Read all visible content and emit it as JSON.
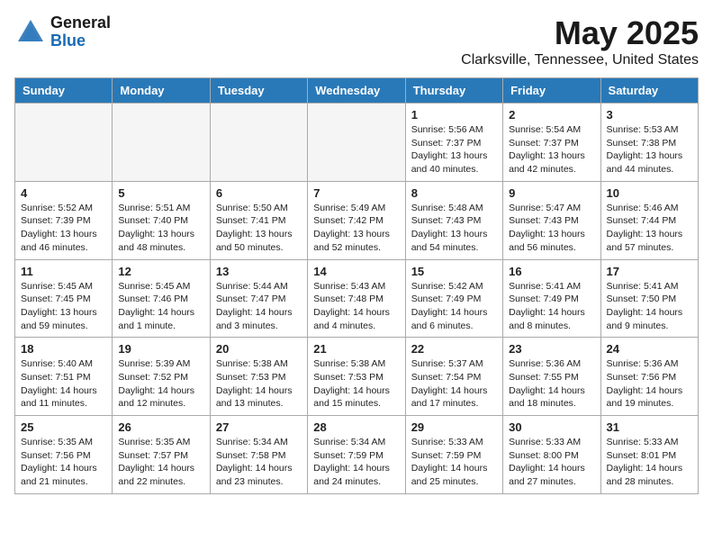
{
  "header": {
    "logo_general": "General",
    "logo_blue": "Blue",
    "month_title": "May 2025",
    "location": "Clarksville, Tennessee, United States"
  },
  "weekdays": [
    "Sunday",
    "Monday",
    "Tuesday",
    "Wednesday",
    "Thursday",
    "Friday",
    "Saturday"
  ],
  "weeks": [
    [
      {
        "day": "",
        "info": ""
      },
      {
        "day": "",
        "info": ""
      },
      {
        "day": "",
        "info": ""
      },
      {
        "day": "",
        "info": ""
      },
      {
        "day": "1",
        "info": "Sunrise: 5:56 AM\nSunset: 7:37 PM\nDaylight: 13 hours\nand 40 minutes."
      },
      {
        "day": "2",
        "info": "Sunrise: 5:54 AM\nSunset: 7:37 PM\nDaylight: 13 hours\nand 42 minutes."
      },
      {
        "day": "3",
        "info": "Sunrise: 5:53 AM\nSunset: 7:38 PM\nDaylight: 13 hours\nand 44 minutes."
      }
    ],
    [
      {
        "day": "4",
        "info": "Sunrise: 5:52 AM\nSunset: 7:39 PM\nDaylight: 13 hours\nand 46 minutes."
      },
      {
        "day": "5",
        "info": "Sunrise: 5:51 AM\nSunset: 7:40 PM\nDaylight: 13 hours\nand 48 minutes."
      },
      {
        "day": "6",
        "info": "Sunrise: 5:50 AM\nSunset: 7:41 PM\nDaylight: 13 hours\nand 50 minutes."
      },
      {
        "day": "7",
        "info": "Sunrise: 5:49 AM\nSunset: 7:42 PM\nDaylight: 13 hours\nand 52 minutes."
      },
      {
        "day": "8",
        "info": "Sunrise: 5:48 AM\nSunset: 7:43 PM\nDaylight: 13 hours\nand 54 minutes."
      },
      {
        "day": "9",
        "info": "Sunrise: 5:47 AM\nSunset: 7:43 PM\nDaylight: 13 hours\nand 56 minutes."
      },
      {
        "day": "10",
        "info": "Sunrise: 5:46 AM\nSunset: 7:44 PM\nDaylight: 13 hours\nand 57 minutes."
      }
    ],
    [
      {
        "day": "11",
        "info": "Sunrise: 5:45 AM\nSunset: 7:45 PM\nDaylight: 13 hours\nand 59 minutes."
      },
      {
        "day": "12",
        "info": "Sunrise: 5:45 AM\nSunset: 7:46 PM\nDaylight: 14 hours\nand 1 minute."
      },
      {
        "day": "13",
        "info": "Sunrise: 5:44 AM\nSunset: 7:47 PM\nDaylight: 14 hours\nand 3 minutes."
      },
      {
        "day": "14",
        "info": "Sunrise: 5:43 AM\nSunset: 7:48 PM\nDaylight: 14 hours\nand 4 minutes."
      },
      {
        "day": "15",
        "info": "Sunrise: 5:42 AM\nSunset: 7:49 PM\nDaylight: 14 hours\nand 6 minutes."
      },
      {
        "day": "16",
        "info": "Sunrise: 5:41 AM\nSunset: 7:49 PM\nDaylight: 14 hours\nand 8 minutes."
      },
      {
        "day": "17",
        "info": "Sunrise: 5:41 AM\nSunset: 7:50 PM\nDaylight: 14 hours\nand 9 minutes."
      }
    ],
    [
      {
        "day": "18",
        "info": "Sunrise: 5:40 AM\nSunset: 7:51 PM\nDaylight: 14 hours\nand 11 minutes."
      },
      {
        "day": "19",
        "info": "Sunrise: 5:39 AM\nSunset: 7:52 PM\nDaylight: 14 hours\nand 12 minutes."
      },
      {
        "day": "20",
        "info": "Sunrise: 5:38 AM\nSunset: 7:53 PM\nDaylight: 14 hours\nand 13 minutes."
      },
      {
        "day": "21",
        "info": "Sunrise: 5:38 AM\nSunset: 7:53 PM\nDaylight: 14 hours\nand 15 minutes."
      },
      {
        "day": "22",
        "info": "Sunrise: 5:37 AM\nSunset: 7:54 PM\nDaylight: 14 hours\nand 17 minutes."
      },
      {
        "day": "23",
        "info": "Sunrise: 5:36 AM\nSunset: 7:55 PM\nDaylight: 14 hours\nand 18 minutes."
      },
      {
        "day": "24",
        "info": "Sunrise: 5:36 AM\nSunset: 7:56 PM\nDaylight: 14 hours\nand 19 minutes."
      }
    ],
    [
      {
        "day": "25",
        "info": "Sunrise: 5:35 AM\nSunset: 7:56 PM\nDaylight: 14 hours\nand 21 minutes."
      },
      {
        "day": "26",
        "info": "Sunrise: 5:35 AM\nSunset: 7:57 PM\nDaylight: 14 hours\nand 22 minutes."
      },
      {
        "day": "27",
        "info": "Sunrise: 5:34 AM\nSunset: 7:58 PM\nDaylight: 14 hours\nand 23 minutes."
      },
      {
        "day": "28",
        "info": "Sunrise: 5:34 AM\nSunset: 7:59 PM\nDaylight: 14 hours\nand 24 minutes."
      },
      {
        "day": "29",
        "info": "Sunrise: 5:33 AM\nSunset: 7:59 PM\nDaylight: 14 hours\nand 25 minutes."
      },
      {
        "day": "30",
        "info": "Sunrise: 5:33 AM\nSunset: 8:00 PM\nDaylight: 14 hours\nand 27 minutes."
      },
      {
        "day": "31",
        "info": "Sunrise: 5:33 AM\nSunset: 8:01 PM\nDaylight: 14 hours\nand 28 minutes."
      }
    ]
  ]
}
